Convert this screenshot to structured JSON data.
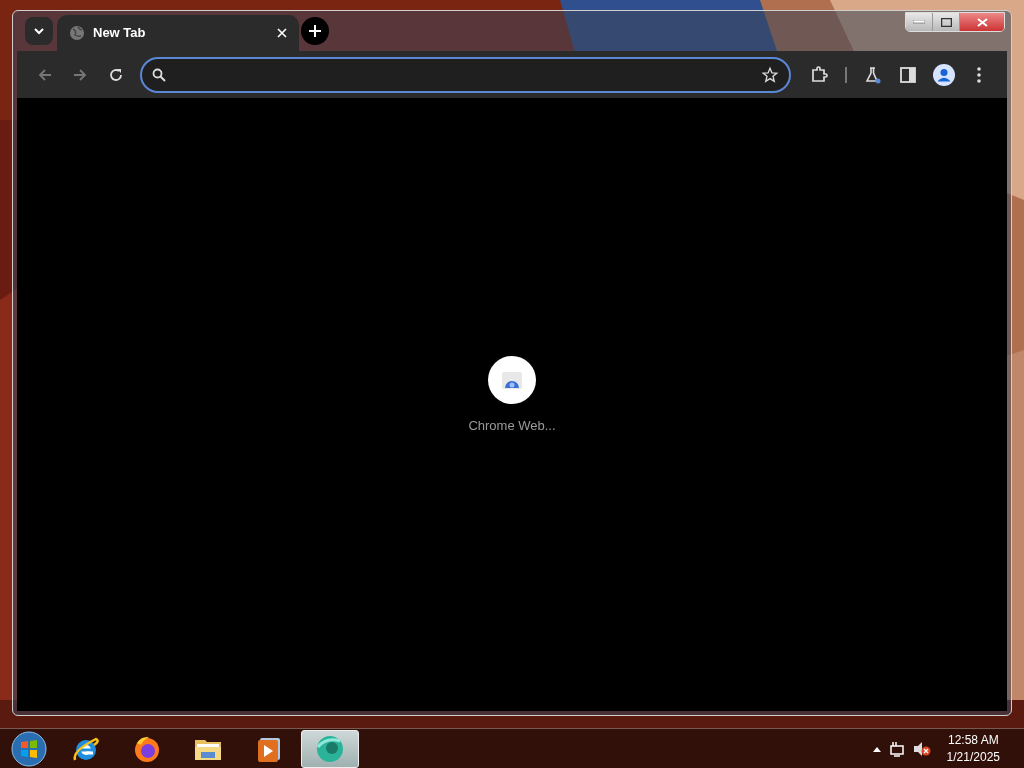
{
  "tab": {
    "title": "New Tab",
    "selected": true
  },
  "address_bar": {
    "focused": true
  },
  "page": {
    "tile_label": "Chrome Web..."
  },
  "taskbar": {
    "apps": [
      {
        "kind": "ie",
        "selected": false
      },
      {
        "kind": "firefox",
        "selected": false
      },
      {
        "kind": "folder",
        "selected": false
      },
      {
        "kind": "media",
        "selected": false
      },
      {
        "kind": "canary",
        "selected": true
      }
    ],
    "clock": {
      "time": "12:58 AM",
      "date": "1/21/2025"
    }
  }
}
